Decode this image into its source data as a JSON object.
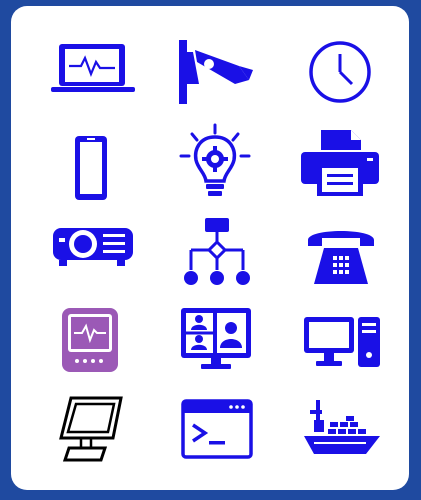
{
  "colors": {
    "frame": "#1f4aa0",
    "card": "#ffffff",
    "primary_blue": "#1a10e6",
    "purple": "#9b59b6",
    "black": "#000000"
  },
  "icons": [
    {
      "name": "laptop-heartbeat-icon"
    },
    {
      "name": "security-camera-icon"
    },
    {
      "name": "clock-icon"
    },
    {
      "name": "smartphone-icon"
    },
    {
      "name": "lightbulb-gear-icon"
    },
    {
      "name": "printer-icon"
    },
    {
      "name": "projector-icon"
    },
    {
      "name": "network-hierarchy-icon"
    },
    {
      "name": "desk-telephone-icon"
    },
    {
      "name": "patient-monitor-icon"
    },
    {
      "name": "video-conference-icon"
    },
    {
      "name": "desktop-computer-icon"
    },
    {
      "name": "kiosk-terminal-icon"
    },
    {
      "name": "terminal-window-icon"
    },
    {
      "name": "cargo-ship-icon"
    }
  ]
}
